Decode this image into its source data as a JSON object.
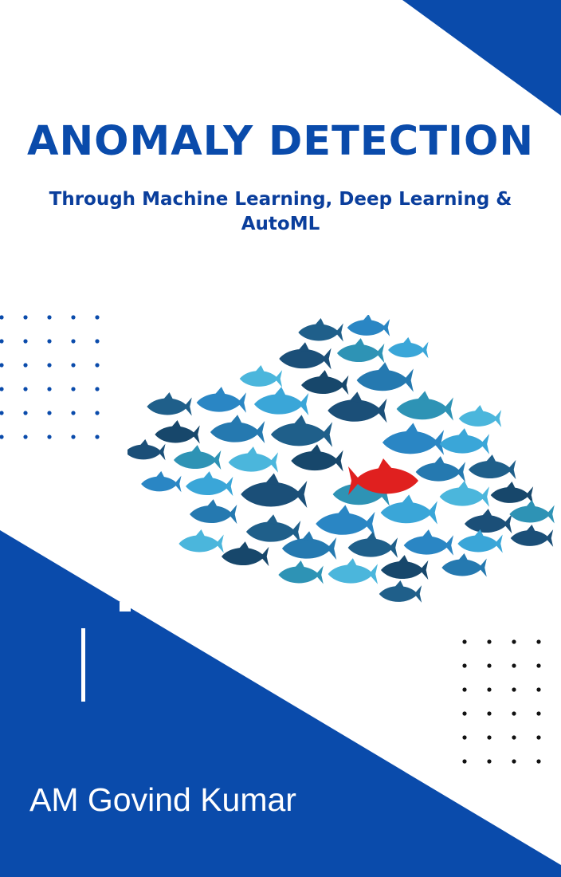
{
  "cover": {
    "title": "ANOMALY DETECTION",
    "subtitle": "Through Machine Learning, Deep Learning & AutoML",
    "author": "AM Govind Kumar"
  },
  "colors": {
    "primary_blue": "#0a4bab",
    "outlier_fish": "#e0201f",
    "white": "#ffffff"
  },
  "icons": {
    "illustration": "school-of-fish-with-red-outlier"
  }
}
